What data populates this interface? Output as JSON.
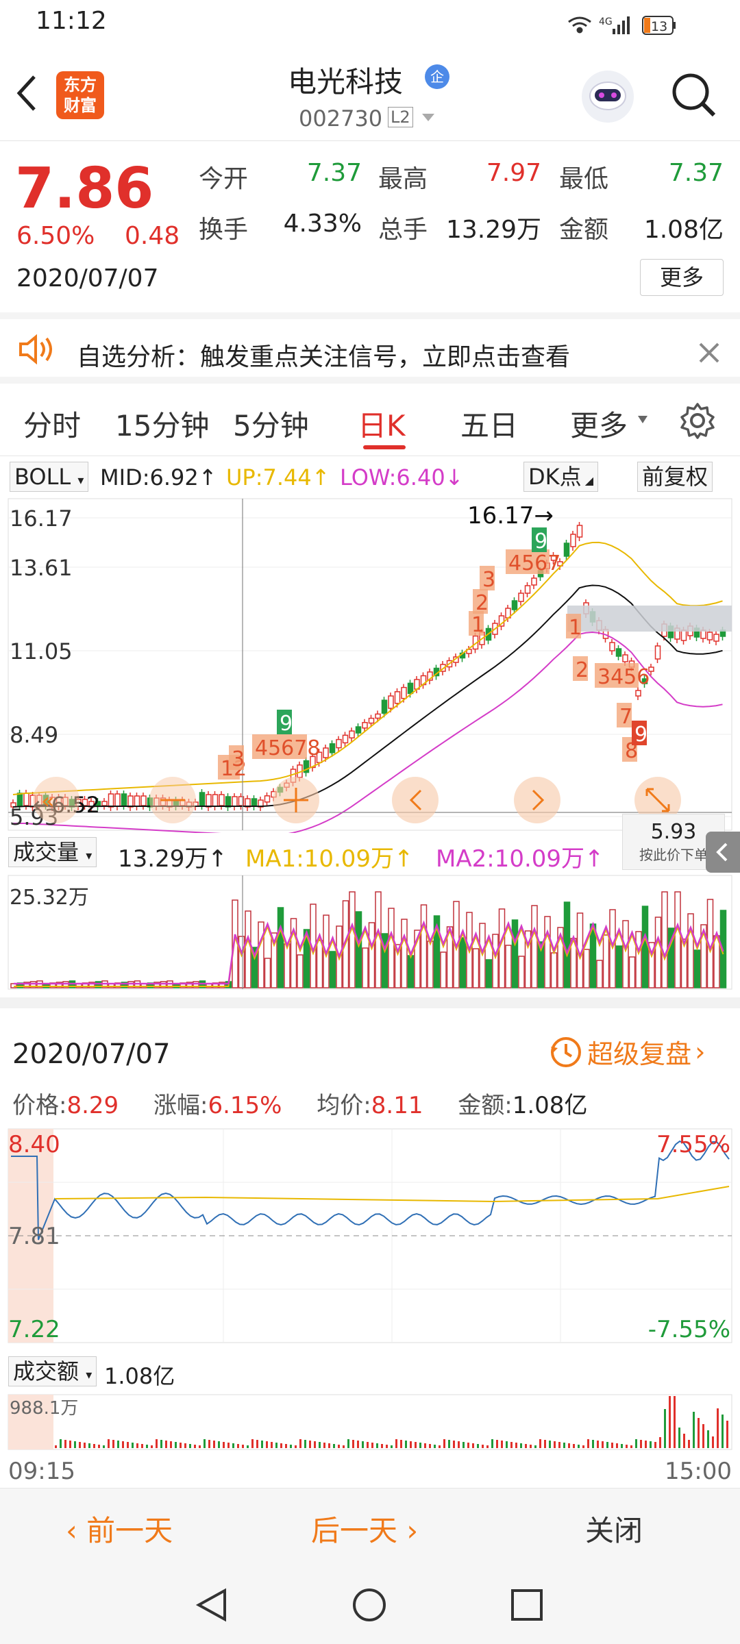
{
  "status_bar": {
    "time": "11:12",
    "network": "4G",
    "battery": "13"
  },
  "header": {
    "app_logo": "东方\n财富",
    "stock_name": "电光科技",
    "badge": "企",
    "stock_code": "002730",
    "level": "L2"
  },
  "quote": {
    "price": "7.86",
    "change_pct": "6.50%",
    "change": "0.48",
    "date": "2020/07/07",
    "fields": [
      {
        "label": "今开",
        "value": "7.37",
        "color": "#1f9b3a"
      },
      {
        "label": "最高",
        "value": "7.97",
        "color": "#e0302b"
      },
      {
        "label": "最低",
        "value": "7.37",
        "color": "#1f9b3a"
      },
      {
        "label": "换手",
        "value": "4.33%",
        "color": "#222222"
      },
      {
        "label": "总手",
        "value": "13.29万",
        "color": "#222222"
      },
      {
        "label": "金额",
        "value": "1.08亿",
        "color": "#222222"
      }
    ],
    "more": "更多"
  },
  "banner": {
    "text": "自选分析：触发重点关注信号，立即点击查看"
  },
  "tabs": [
    "分时",
    "15分钟",
    "5分钟",
    "日K",
    "五日",
    "更多"
  ],
  "kline": {
    "indicator": "BOLL",
    "mid": "MID:6.92↑",
    "up": "UP:7.44↑",
    "low": "LOW:6.40↓",
    "dk": "DK点",
    "adjust": "前复权",
    "y_labels": [
      "16.17",
      "13.61",
      "11.05",
      "8.49",
      "5.93"
    ],
    "high_marker": "16.17→",
    "low_marker": "←6.52",
    "crosshair_value": "5.93",
    "crosshair_hint": "按此价下单",
    "td_labels": [
      "12",
      "3",
      "45678",
      "9",
      "1",
      "2",
      "3",
      "4567",
      "9",
      "1",
      "2",
      "3456",
      "7",
      "8",
      "9"
    ]
  },
  "volume": {
    "indicator": "成交量",
    "value": "13.29万↑",
    "ma1": "MA1:10.09万↑",
    "ma2": "MA2:10.09万↑",
    "max_label": "25.32万"
  },
  "intraday": {
    "date": "2020/07/07",
    "replay": "超级复盘",
    "price_label": "价格:",
    "price": "8.29",
    "pct_label": "涨幅:",
    "pct": "6.15%",
    "avg_label": "均价:",
    "avg": "8.11",
    "amount_label": "金额:",
    "amount": "1.08亿",
    "y_top": "8.40",
    "y_mid": "7.81",
    "y_bottom": "7.22",
    "pct_top": "7.55%",
    "pct_bottom": "-7.55%",
    "amount_indicator": "成交额",
    "amount_value": "1.08亿",
    "amount_max": "988.1万",
    "time_start": "09:15",
    "time_end": "15:00"
  },
  "bottom_nav": {
    "prev": "前一天",
    "next": "后一天",
    "close": "关闭"
  }
}
